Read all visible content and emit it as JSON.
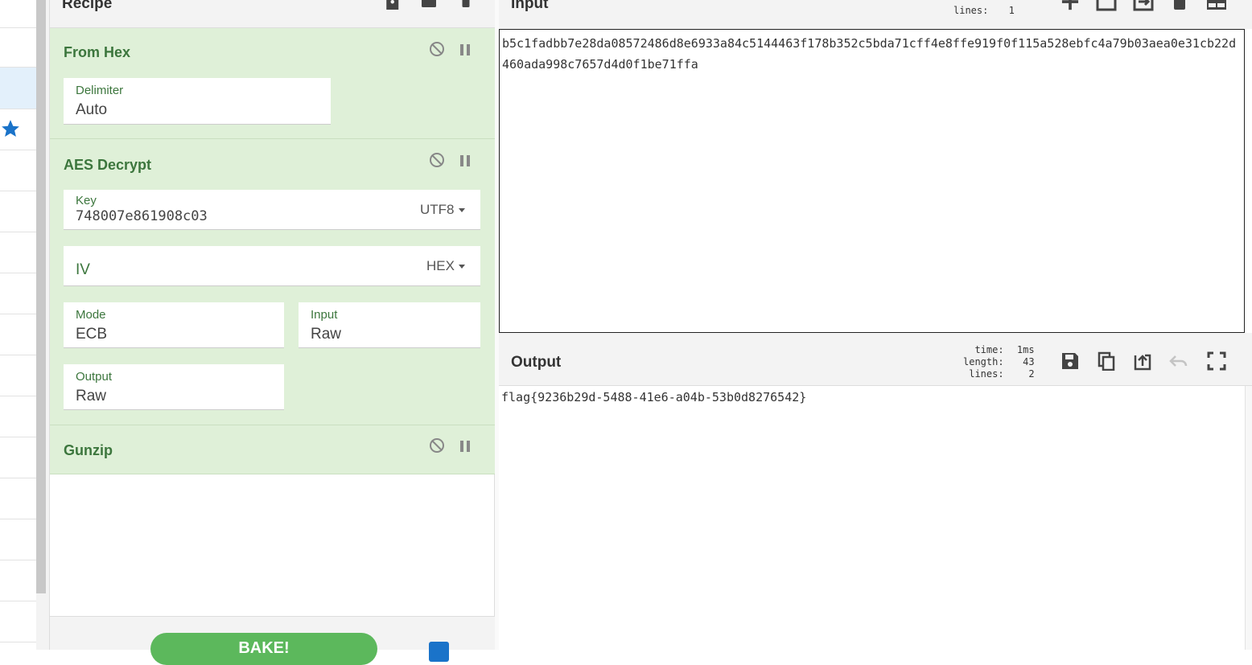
{
  "recipe": {
    "title": "Recipe",
    "operations": [
      {
        "name": "From Hex",
        "args": [
          {
            "label": "Delimiter",
            "value": "Auto"
          }
        ]
      },
      {
        "name": "AES Decrypt",
        "args": [
          {
            "label": "Key",
            "value": "748007e861908c03",
            "encoding": "UTF8"
          },
          {
            "label": "",
            "placeholder": "IV",
            "value": "",
            "encoding": "HEX"
          },
          {
            "label": "Mode",
            "value": "ECB"
          },
          {
            "label": "Input",
            "value": "Raw"
          },
          {
            "label": "Output",
            "value": "Raw"
          }
        ]
      },
      {
        "name": "Gunzip",
        "args": []
      }
    ],
    "bake_label": "BAKE!",
    "auto_bake_checked": true
  },
  "input": {
    "title": "Input",
    "info_lines_label": "lines:",
    "info_lines_value": "1",
    "text": "b5c1fadbb7e28da08572486d8e6933a84c5144463f178b352c5bda71cff4e8ffe919f0f115a528ebfc4a79b03aea0e31cb22d460ada998c7657d4d0f1be71ffa"
  },
  "output": {
    "title": "Output",
    "info": [
      {
        "label": "time:",
        "value": "1ms"
      },
      {
        "label": "length:",
        "value": "43"
      },
      {
        "label": "lines:",
        "value": "2"
      }
    ],
    "text": "flag{9236b29d-5488-41e6-a04b-53b0d8276542}"
  },
  "colors": {
    "op_bg": "#dff0d8",
    "op_title": "#3c763d",
    "bake_green": "#5cb85c",
    "favourite_star": "#1a73c9"
  },
  "icons": [
    "save-icon",
    "folder-icon",
    "trash-icon",
    "plus-icon",
    "window-icon",
    "import-icon",
    "layout-icon",
    "copy-icon",
    "replace-input-icon",
    "undo-icon",
    "maximise-icon",
    "disable-icon",
    "pause-icon",
    "star-icon"
  ]
}
